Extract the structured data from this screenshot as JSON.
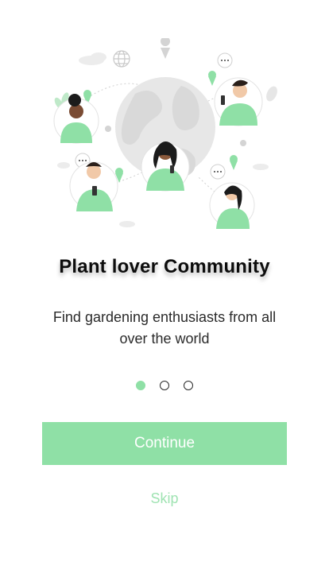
{
  "onboarding": {
    "title": "Plant lover Community",
    "subtitle": "Find gardening enthusiasts from all over the world",
    "pagination": {
      "total": 3,
      "active_index": 0
    },
    "continue_label": "Continue",
    "skip_label": "Skip"
  },
  "colors": {
    "accent": "#8fe0a6",
    "skip_text": "#9fe3b2",
    "globe": "#e6e6e6",
    "text_dark": "#0d0d0d"
  },
  "icons": [
    "globe-illustration",
    "location-pin-icon",
    "chat-bubble-icon",
    "leaf-icon"
  ]
}
